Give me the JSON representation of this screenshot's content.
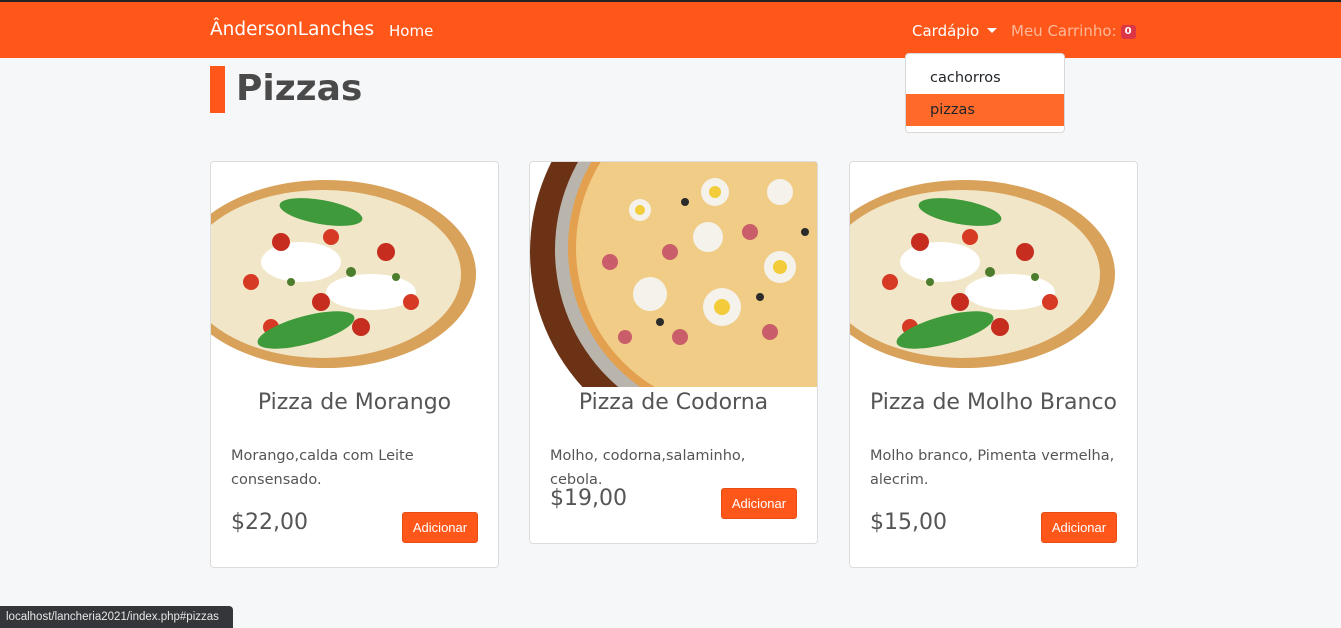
{
  "navbar": {
    "brand": "ÂndersonLanches",
    "home": "Home",
    "menu": "Cardápio",
    "cart_label": "Meu Carrinho:",
    "cart_count": "0",
    "accent_color": "#ff5719"
  },
  "dropdown": {
    "items": [
      {
        "label": "cachorros"
      },
      {
        "label": "pizzas",
        "active": true
      }
    ]
  },
  "section": {
    "title": "Pizzas"
  },
  "products": [
    {
      "image": "pizza-morango-image",
      "title": "Pizza de Morango",
      "description": "Morango,calda com Leite consensado.",
      "price": "$22,00",
      "button": "Adicionar"
    },
    {
      "image": "pizza-codorna-image",
      "title": "Pizza de Codorna",
      "description": "Molho, codorna,salaminho, cebola.",
      "price": "$19,00",
      "button": "Adicionar"
    },
    {
      "image": "pizza-molho-branco-image",
      "title": "Pizza de Molho Branco",
      "description": "Molho branco, Pimenta vermelha, alecrim.",
      "price": "$15,00",
      "button": "Adicionar"
    }
  ],
  "statusbar": {
    "url": "localhost/lancheria2021/index.php#pizzas"
  }
}
